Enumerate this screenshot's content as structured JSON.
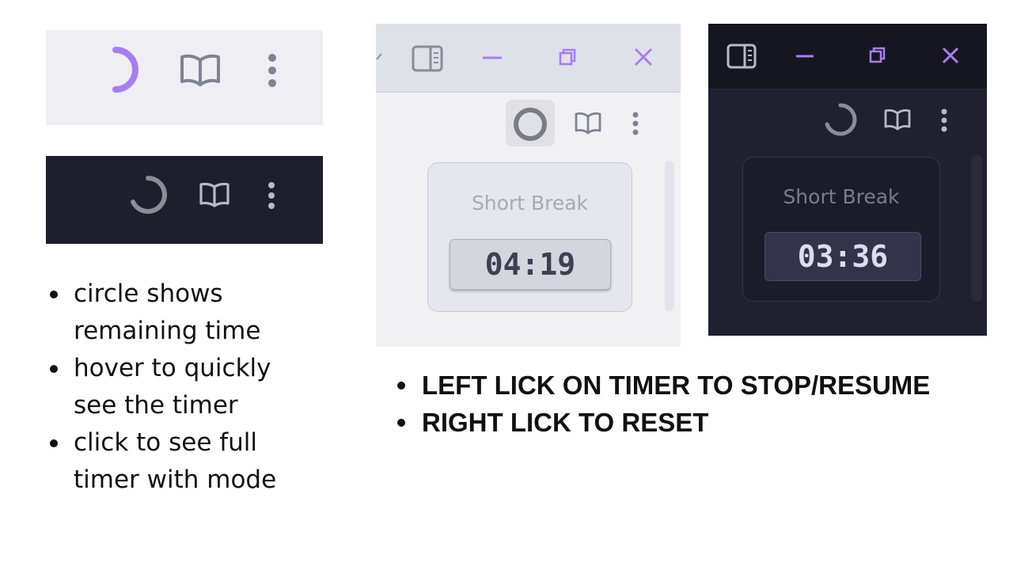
{
  "panels": {
    "light_toolbar": {
      "icons": [
        "progress-ring-icon",
        "book-icon",
        "more-vertical-icon"
      ]
    },
    "dark_toolbar": {
      "icons": [
        "progress-ring-icon",
        "book-icon",
        "more-vertical-icon"
      ]
    },
    "light_window": {
      "titlebar_icons": [
        "chevron-icon",
        "sidebar-toggle-icon",
        "minimize-icon",
        "restore-icon",
        "close-icon"
      ],
      "timer": {
        "mode": "Short Break",
        "time": "04:19"
      }
    },
    "dark_window": {
      "titlebar_icons": [
        "sidebar-toggle-icon",
        "minimize-icon",
        "restore-icon",
        "close-icon"
      ],
      "timer": {
        "mode": "Short Break",
        "time": "03:36"
      }
    }
  },
  "notes": {
    "left": [
      "circle shows remaining time",
      "hover to quickly see the timer",
      "click to see full timer with mode"
    ],
    "right": [
      "LEFT LICK ON TIMER TO STOP/RESUME",
      "RIGHT LICK TO RESET"
    ]
  },
  "colors": {
    "accent_purple": "#a77ef2",
    "light_bg": "#eeeef3",
    "dark_bg": "#1e1e2c",
    "icon_gray": "#7f8393"
  }
}
